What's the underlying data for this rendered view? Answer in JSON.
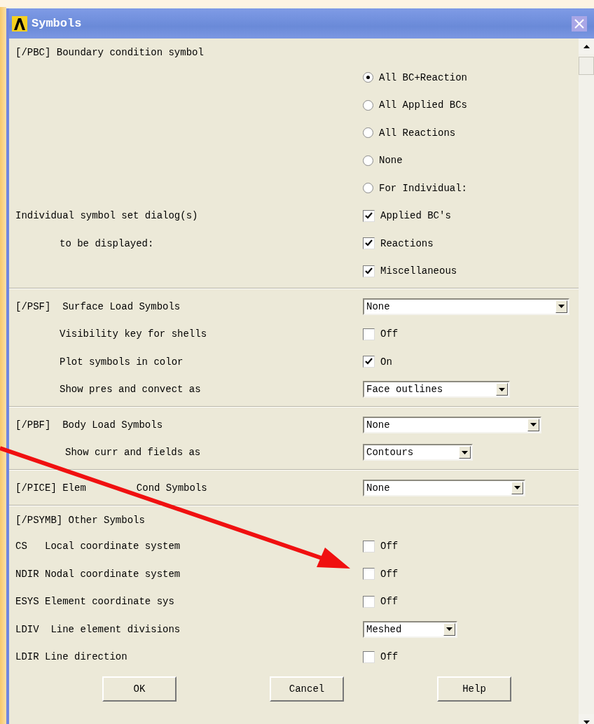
{
  "window": {
    "title": "Symbols"
  },
  "sections": [
    {
      "rows": [
        {
          "label": "[/PBC] Boundary condition symbol"
        },
        {
          "control": {
            "kind": "radio",
            "text": "All BC+Reaction",
            "selected": true
          }
        },
        {
          "control": {
            "kind": "radio",
            "text": "All Applied BCs",
            "selected": false
          }
        },
        {
          "control": {
            "kind": "radio",
            "text": "All Reactions",
            "selected": false
          }
        },
        {
          "control": {
            "kind": "radio",
            "text": "None",
            "selected": false
          }
        },
        {
          "control": {
            "kind": "radio",
            "text": "For Individual:",
            "selected": false
          }
        },
        {
          "label": "Individual symbol set dialog(s)",
          "control": {
            "kind": "checkbox",
            "text": "Applied BC's",
            "checked": true
          }
        },
        {
          "label": "to be displayed:",
          "control": {
            "kind": "checkbox",
            "text": "Reactions",
            "checked": true
          }
        },
        {
          "control": {
            "kind": "checkbox",
            "text": "Miscellaneous",
            "checked": true
          }
        }
      ]
    },
    {
      "rows": [
        {
          "label": "[/PSF]  Surface Load Symbols",
          "control": {
            "kind": "dropdown",
            "value": "None"
          }
        },
        {
          "label": "Visibility key for shells",
          "control": {
            "kind": "checkbox",
            "text": "Off",
            "checked": false
          }
        },
        {
          "label": "Plot symbols in color",
          "control": {
            "kind": "checkbox",
            "text": "On",
            "checked": true
          }
        },
        {
          "label": "Show pres and convect as",
          "control": {
            "kind": "dropdown",
            "value": "Face outlines"
          }
        }
      ]
    },
    {
      "rows": [
        {
          "label": "[/PBF]  Body Load Symbols",
          "control": {
            "kind": "dropdown",
            "value": "None"
          }
        },
        {
          "label": "Show curr and fields as",
          "control": {
            "kind": "dropdown",
            "value": "Contours"
          }
        }
      ]
    },
    {
      "rows": [
        {
          "label": "[/PICE] Elem",
          "label_continued": "Cond Symbols",
          "control": {
            "kind": "dropdown",
            "value": "None"
          }
        }
      ]
    },
    {
      "rows": [
        {
          "label": "[/PSYMB] Other Symbols"
        },
        {
          "label": "CS   Local coordinate system",
          "control": {
            "kind": "checkbox",
            "text": "Off",
            "checked": false
          }
        },
        {
          "label": "NDIR Nodal coordinate system",
          "control": {
            "kind": "checkbox",
            "text": "Off",
            "checked": false
          }
        },
        {
          "label": "ESYS Element coordinate sys",
          "control": {
            "kind": "checkbox",
            "text": "Off",
            "checked": false
          }
        },
        {
          "label": "LDIV  Line element divisions",
          "control": {
            "kind": "dropdown",
            "value": "Meshed"
          }
        },
        {
          "label": "LDIR Line direction",
          "control": {
            "kind": "checkbox",
            "text": "Off",
            "checked": false
          }
        }
      ]
    }
  ],
  "buttons": [
    "OK",
    "Cancel",
    "Help"
  ]
}
